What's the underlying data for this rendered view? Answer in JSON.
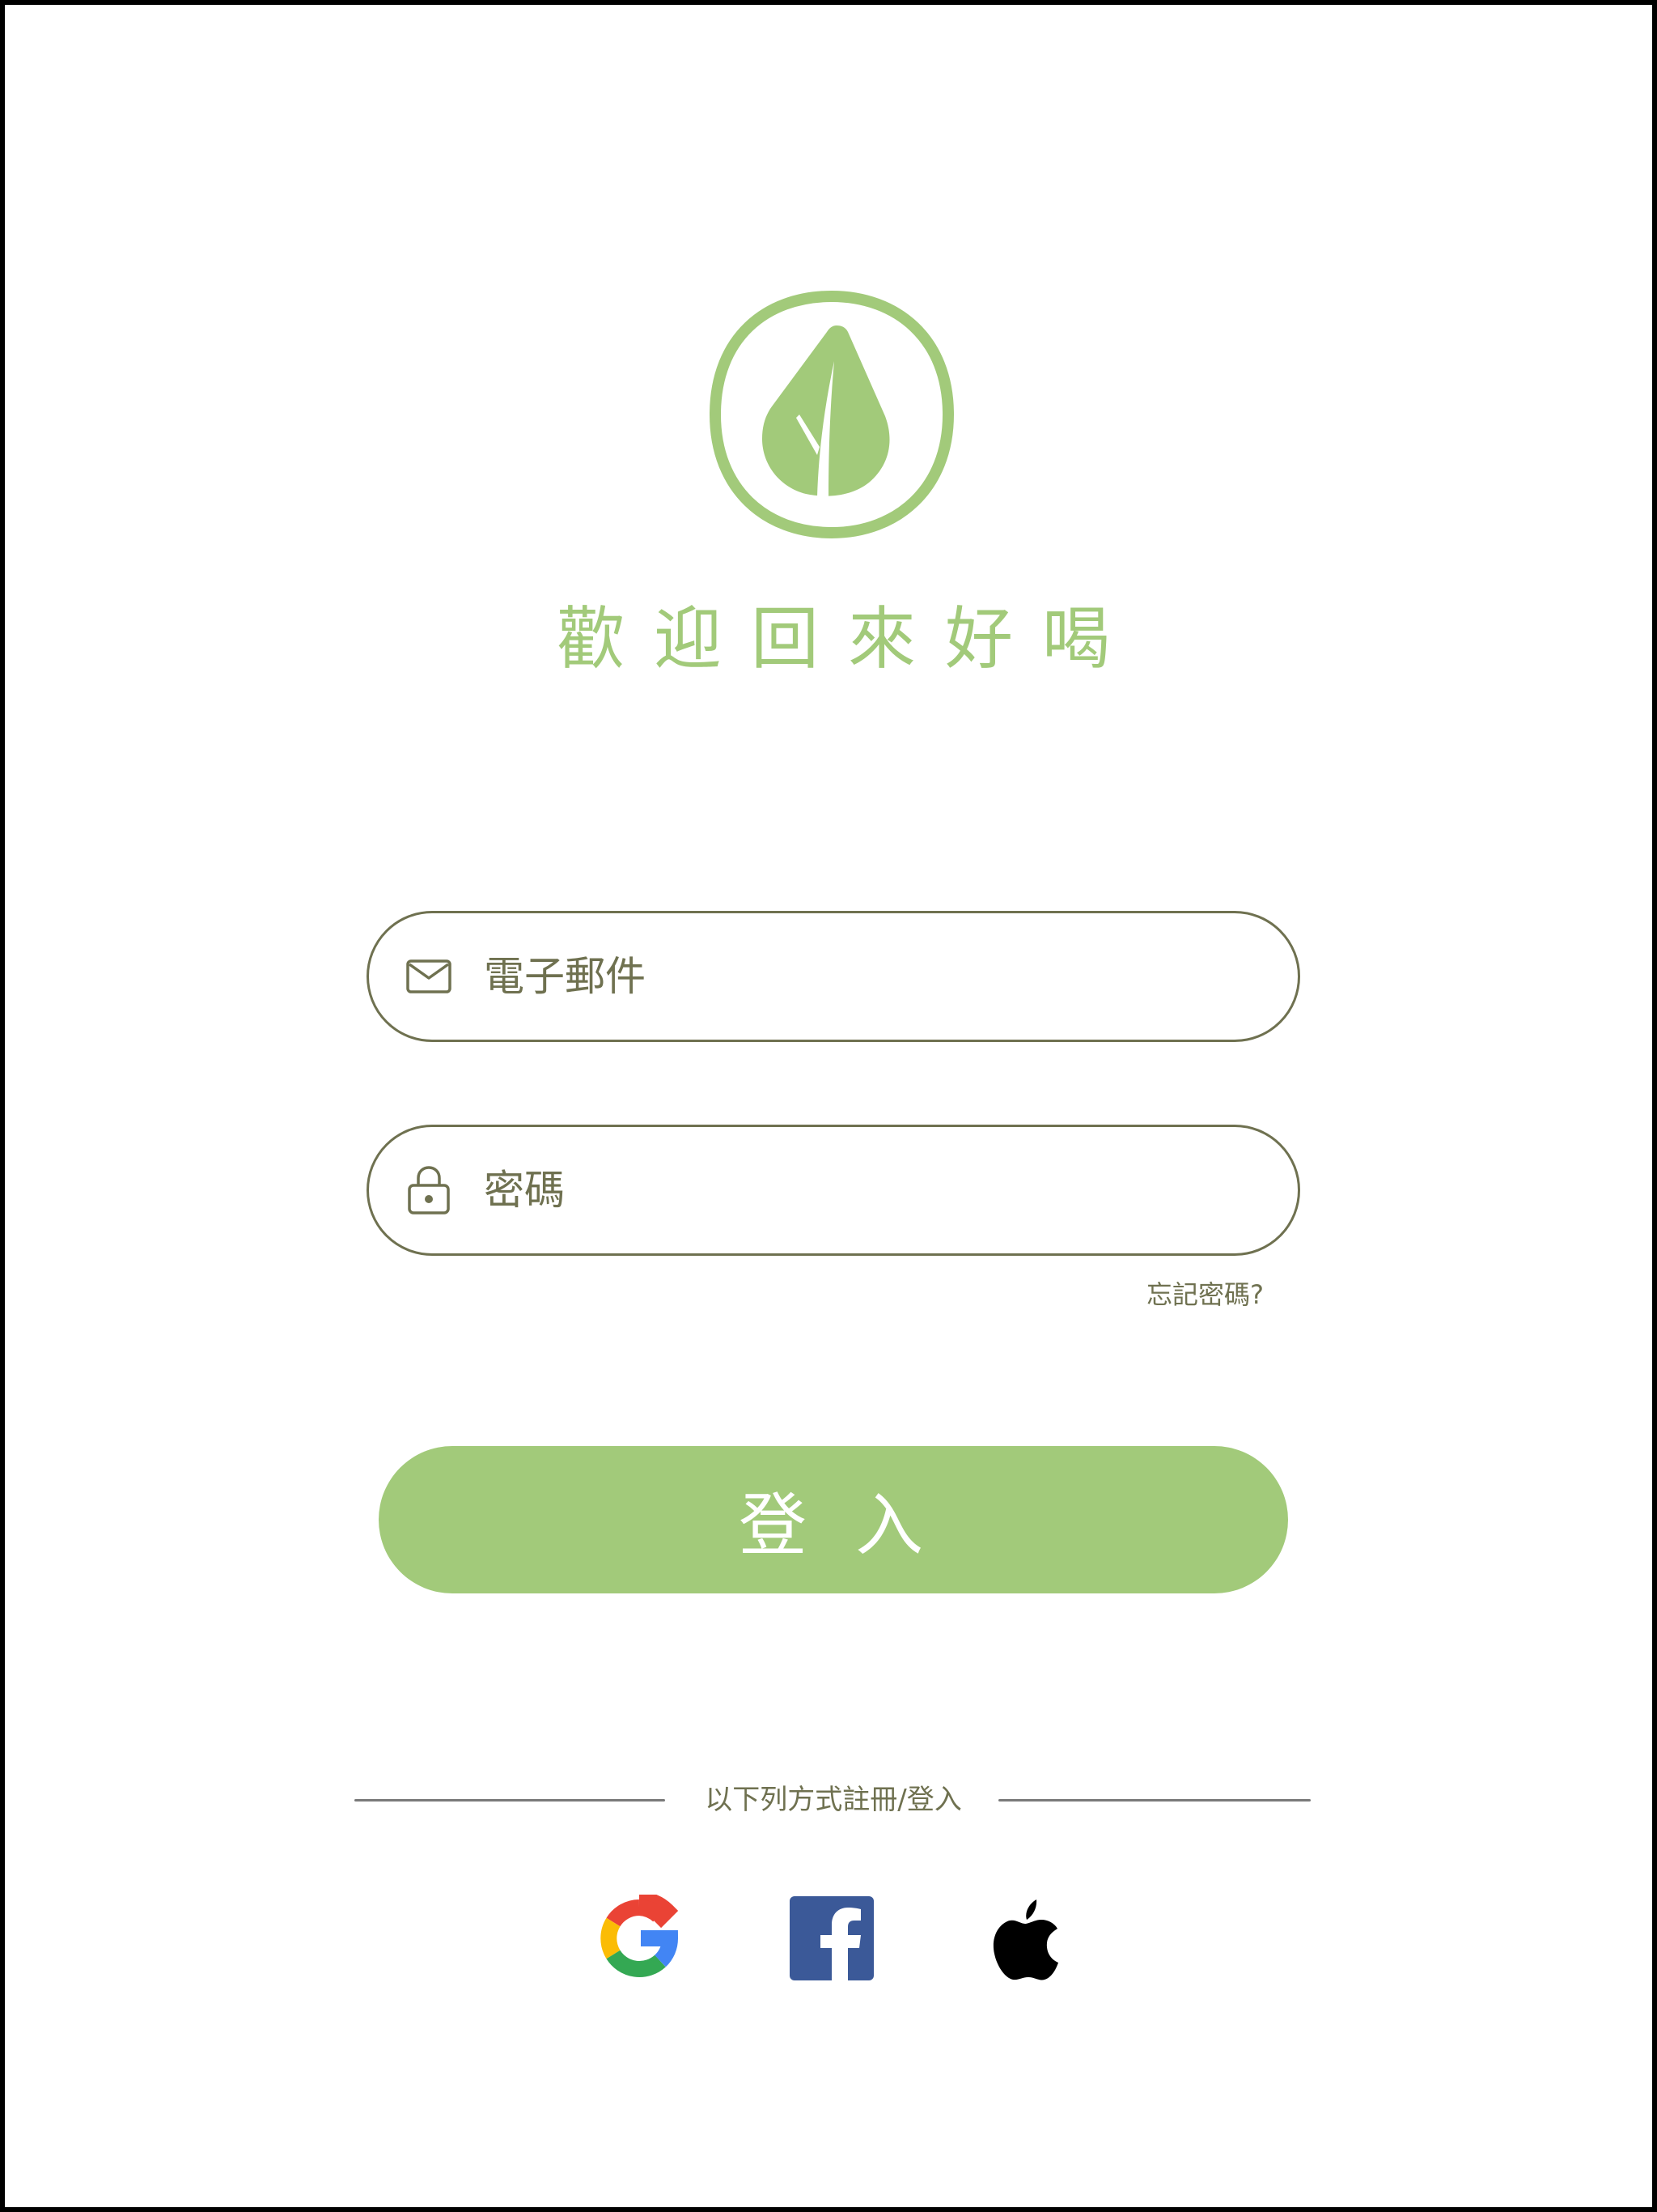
{
  "app": {
    "title": "歡迎回來好喝",
    "brand_color": "#a2ca7a",
    "text_color": "#6f7150"
  },
  "logo": {
    "icon": "leaf-logo-icon"
  },
  "form": {
    "email": {
      "icon": "mail-icon",
      "placeholder": "電子郵件",
      "value": ""
    },
    "password": {
      "icon": "lock-icon",
      "placeholder": "密碼",
      "value": ""
    },
    "forgot_label": "忘記密碼?",
    "login_label": "登入"
  },
  "social": {
    "divider_label": "以下列方式註冊/登入",
    "providers": [
      {
        "name": "Google",
        "icon": "google-icon"
      },
      {
        "name": "Facebook",
        "icon": "facebook-icon"
      },
      {
        "name": "Apple",
        "icon": "apple-icon"
      }
    ]
  }
}
